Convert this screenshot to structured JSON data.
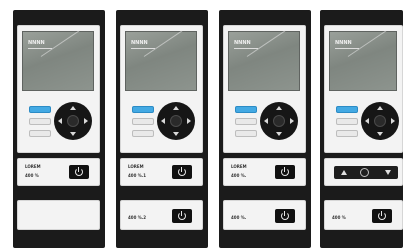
{
  "remotes": [
    {
      "screen_text": "NNNN",
      "label1": "LOREM",
      "label2": "400 %",
      "label3": ""
    },
    {
      "screen_text": "NNNN",
      "label1": "LOREM",
      "label2": "400 %.1",
      "label3": "400 %.2"
    },
    {
      "screen_text": "NNNN",
      "label1": "LOREM",
      "label2": "400 %.",
      "label3": "400 %."
    },
    {
      "screen_text": "NNNN",
      "label1": "",
      "label2": "",
      "label3": "400 %"
    }
  ],
  "colors": {
    "accent": "#43a9e3",
    "panel": "#1b1b1b",
    "button": "#111111"
  },
  "icons": [
    "power-icon",
    "arrow-up-icon",
    "arrow-down-icon",
    "dpad-icon"
  ]
}
